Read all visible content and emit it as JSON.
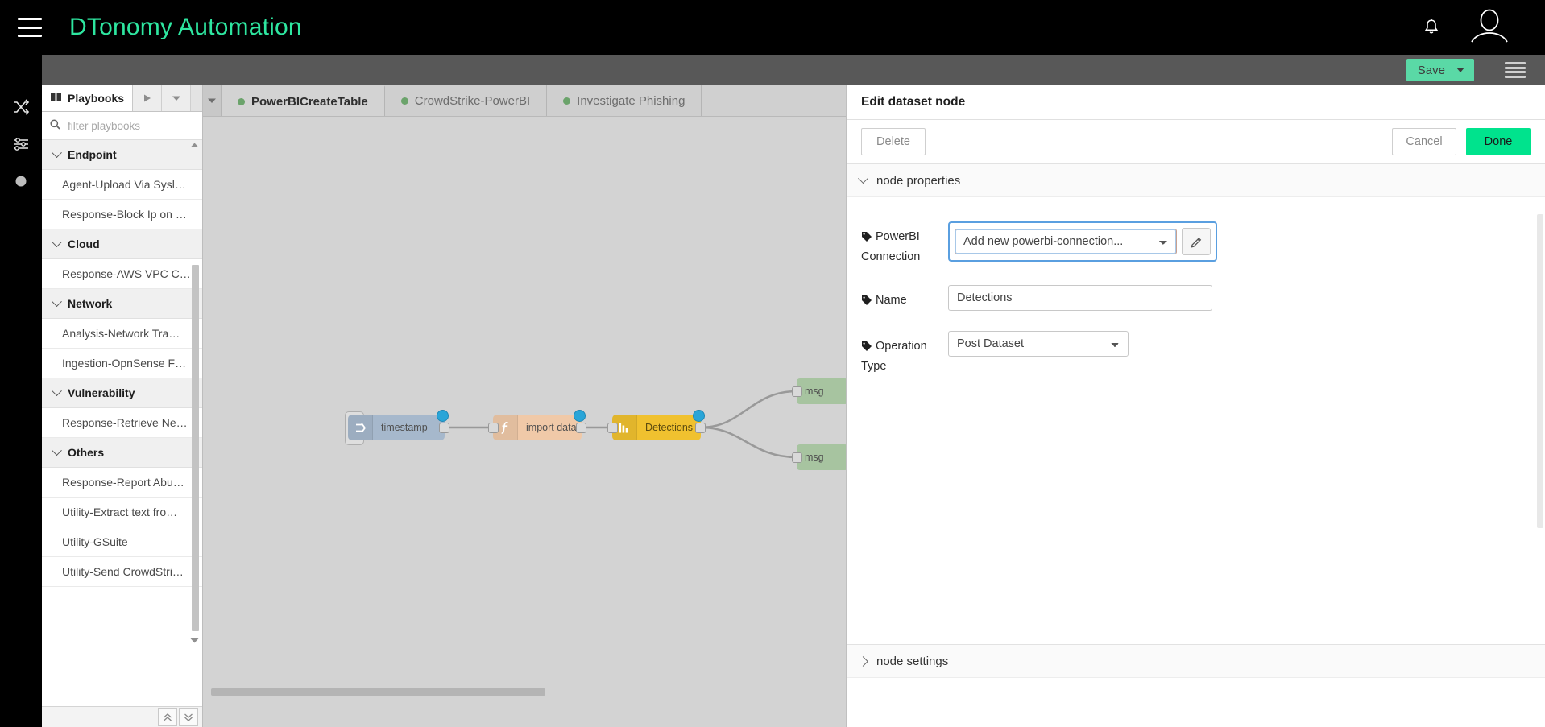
{
  "header": {
    "menu_icon": "hamburger-icon",
    "brand": "DTonomy Automation",
    "notification_icon": "bell-icon",
    "account_icon": "user-avatar-icon"
  },
  "toolbar": {
    "save_label": "Save",
    "save_dropdown_icon": "caret-down-icon",
    "menu_icon": "hamburger-icon"
  },
  "left_rail": {
    "items": [
      {
        "icon": "shuffle-icon",
        "name": "rail-shuffle"
      },
      {
        "icon": "sliders-icon",
        "name": "rail-sliders"
      },
      {
        "icon": "circle-icon",
        "name": "rail-status"
      }
    ]
  },
  "sidebar": {
    "tab_label": "Playbooks",
    "tab_icon": "book-icon",
    "run_icon": "play-icon",
    "dropdown_icon": "caret-down-icon",
    "search_icon": "search-icon",
    "search_placeholder": "filter playbooks",
    "search_value": "",
    "groups": [
      {
        "label": "Endpoint",
        "items": [
          "Agent-Upload Via Sysl…",
          "Response-Block Ip on …"
        ]
      },
      {
        "label": "Cloud",
        "items": [
          "Response-AWS VPC C…"
        ]
      },
      {
        "label": "Network",
        "items": [
          "Analysis-Network Tra…",
          "Ingestion-OpnSense F…"
        ]
      },
      {
        "label": "Vulnerability",
        "items": [
          "Response-Retrieve Ne…"
        ]
      },
      {
        "label": "Others",
        "items": [
          "Response-Report Abu…",
          "Utility-Extract text fro…",
          "Utility-GSuite",
          "Utility-Send CrowdStri…"
        ]
      }
    ],
    "footer": {
      "collapse_all_label": "«",
      "expand_all_label": "»"
    }
  },
  "canvas": {
    "tab_scroll_icon": "caret-down-icon",
    "tabs": [
      {
        "label": "PowerBICreateTable",
        "active": true
      },
      {
        "label": "CrowdStrike-PowerBI",
        "active": false
      },
      {
        "label": "Investigate Phishing",
        "active": false
      }
    ],
    "nodes": [
      {
        "id": "timestamp",
        "label": "timestamp",
        "icon": "inject-arrow-icon",
        "color": "#a6b8cc"
      },
      {
        "id": "importdata",
        "label": "import data",
        "icon": "function-f-icon",
        "color": "#f0c9a8"
      },
      {
        "id": "detections",
        "label": "Detections",
        "icon": "bar-chart-icon",
        "color": "#f0c12f"
      },
      {
        "id": "msg1",
        "label": "msg",
        "icon": "debug-icon",
        "color": "#a7c4a0"
      },
      {
        "id": "msg2",
        "label": "msg",
        "icon": "debug-icon",
        "color": "#a7c4a0"
      }
    ]
  },
  "edit_panel": {
    "title": "Edit dataset node",
    "delete_label": "Delete",
    "cancel_label": "Cancel",
    "done_label": "Done",
    "properties_section": "node properties",
    "settings_section": "node settings",
    "fields": {
      "connection": {
        "label_line1": "PowerBI",
        "label_line2": "Connection",
        "icon": "tag-icon",
        "value": "Add new powerbi-connection...",
        "edit_icon": "pencil-icon"
      },
      "name": {
        "label": "Name",
        "icon": "tag-icon",
        "value": "Detections"
      },
      "operation_type": {
        "label_line1": "Operation",
        "label_line2": "Type",
        "icon": "tag-icon",
        "value": "Post Dataset"
      }
    }
  },
  "colors": {
    "brand_green": "#2ee6a0",
    "save_green": "#5ad9a6",
    "done_green": "#00e38d",
    "highlight_blue": "#5a9fe0",
    "header_black": "#000000",
    "toolbar_grey": "#585858",
    "canvas_grey": "#d3d3d3"
  }
}
